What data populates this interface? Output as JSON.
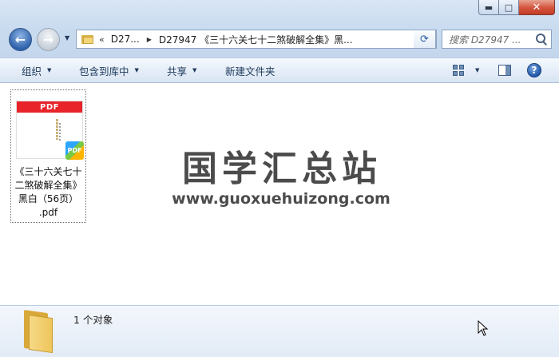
{
  "window": {
    "caption": {
      "minimize": "▬",
      "maximize": "□",
      "close": "✕"
    }
  },
  "nav": {
    "back_glyph": "←",
    "forward_glyph": "→",
    "recent_glyph": "▼",
    "breadcrumb_overflow": "«",
    "breadcrumb": [
      "D27...",
      "D27947 《三十六关七十二煞破解全集》黑..."
    ],
    "breadcrumb_sep": "▶",
    "address_dropdown": "▼",
    "refresh_glyph": "⟳",
    "search_placeholder": "搜索 D27947 ..."
  },
  "toolbar": {
    "organize": "组织",
    "include_in_library": "包含到库中",
    "share": "共享",
    "new_folder": "新建文件夹",
    "dropdown_arrow": "▼",
    "help": "?"
  },
  "files": [
    {
      "name": "《三十六关七十二煞破解全集》黑白（56页）.pdf",
      "name_lines": [
        "《三十六关七十",
        "二煞破解全集》",
        "黑白（56页）",
        ".pdf"
      ],
      "thumb_banner": "PDF",
      "badge": "PDF"
    }
  ],
  "watermark": {
    "title": "国学汇总站",
    "url": "www.guoxuehuizong.com"
  },
  "details": {
    "item_count": "1 个对象"
  },
  "icons": {
    "folder": "folder-icon",
    "search": "search-icon",
    "help": "help-icon",
    "views": "change-view-icon",
    "preview": "preview-pane-icon"
  }
}
